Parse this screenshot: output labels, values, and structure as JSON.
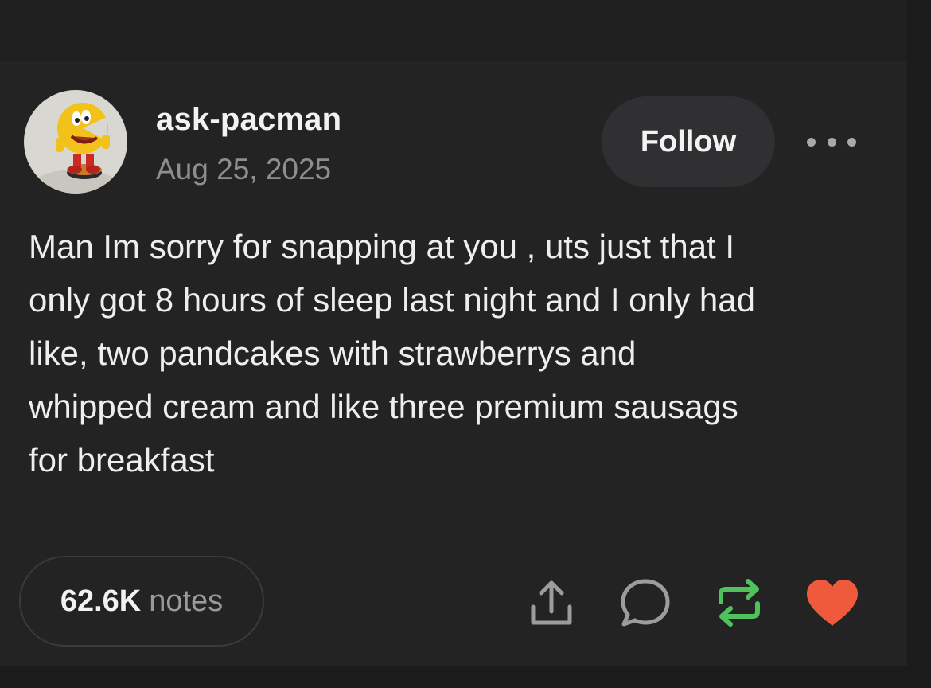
{
  "post": {
    "username": "ask-pacman",
    "date": "Aug 25, 2025",
    "follow_label": "Follow",
    "body": "Man Im sorry for snapping at you , uts just that I\nonly got 8 hours of sleep last night and I only had\nlike, two pandcakes with strawberrys and\nwhipped cream and like three premium sausags\nfor breakfast",
    "avatar": "pacman-figurine"
  },
  "footer": {
    "notes_count": "62.6K",
    "notes_label": "notes",
    "actions": [
      "share-icon",
      "reply-icon",
      "reblog-icon",
      "like-icon"
    ]
  },
  "colors": {
    "background": "#232324",
    "reblog": "#4fc25c",
    "like": "#ef5a3c",
    "icon": "#9c9c9e"
  }
}
